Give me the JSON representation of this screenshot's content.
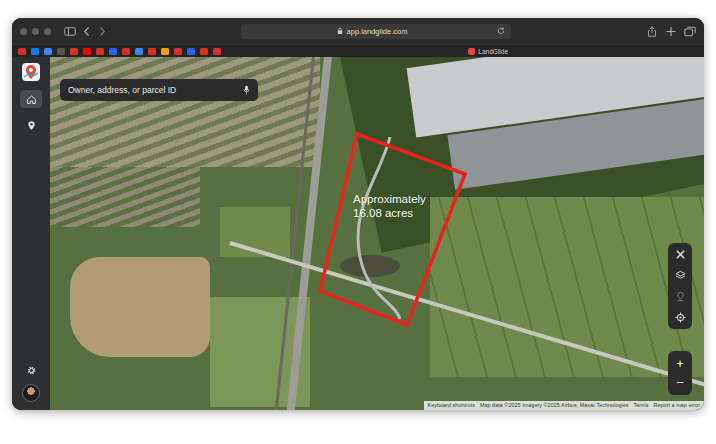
{
  "window": {
    "url": "app.landglide.com"
  },
  "tab": {
    "title": "LandGlide"
  },
  "sidebar": {
    "items": [
      {
        "selected": true
      },
      {
        "selected": false
      }
    ]
  },
  "search": {
    "placeholder": "Owner, address, or parcel ID"
  },
  "annotation": {
    "lines": [
      "Approximately",
      "16.08 acres"
    ]
  },
  "zoom": {
    "in": "+",
    "out": "−"
  },
  "attribution": [
    "Keyboard shortcuts",
    "Map data ©2025 Imagery ©2025 Airbus, Maxar Technologies",
    "Terms",
    "Report a map error"
  ]
}
